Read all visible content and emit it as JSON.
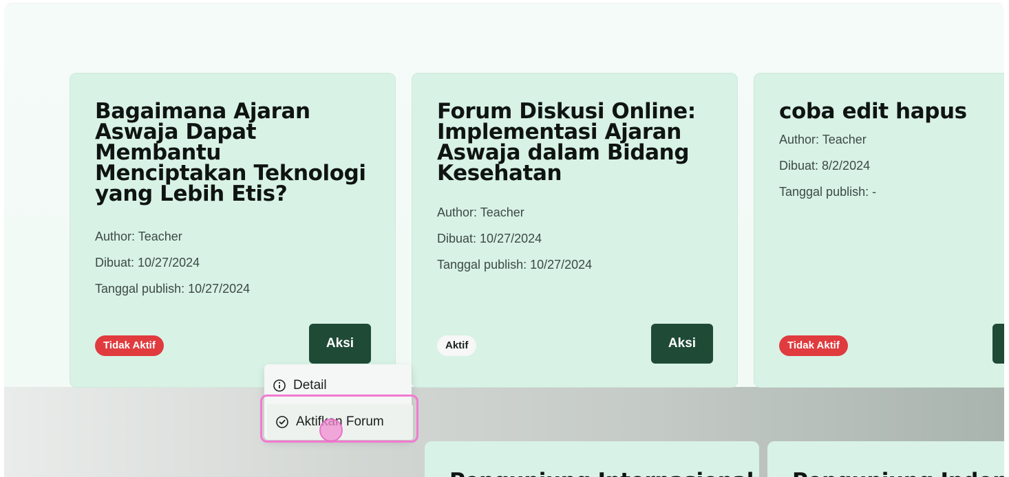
{
  "cards": [
    {
      "title": "Bagaimana Ajaran Aswaja Dapat Membantu Menciptakan Teknologi yang Lebih Etis?",
      "author": "Author: Teacher",
      "created": "Dibuat: 10/27/2024",
      "published": "Tanggal publish: 10/27/2024",
      "status": "Tidak Aktif",
      "action": "Aksi"
    },
    {
      "title": "Forum Diskusi Online: Implementasi Ajaran Aswaja dalam Bidang Kesehatan",
      "author": "Author: Teacher",
      "created": "Dibuat: 10/27/2024",
      "published": "Tanggal publish: 10/27/2024",
      "status": "Aktif",
      "action": "Aksi"
    },
    {
      "title": "coba edit hapus",
      "author": "Author: Teacher",
      "created": "Dibuat: 8/2/2024",
      "published": "Tanggal publish: -",
      "status": "Tidak Aktif",
      "action": ""
    }
  ],
  "dropdown": {
    "detail_label": "Detail",
    "activate_label": "Aktifkan Forum",
    "detail_icon": "info-icon",
    "activate_icon": "check-circle-icon"
  },
  "lower_cards": [
    {
      "title": "Pengunjung Internasional"
    },
    {
      "title": "Pengunjung Indonesia"
    }
  ],
  "colors": {
    "card_bg": "#d8f2e6",
    "button_bg": "#1f4a36",
    "inactive_badge": "#e03b3e",
    "highlight": "#f27ad0"
  }
}
